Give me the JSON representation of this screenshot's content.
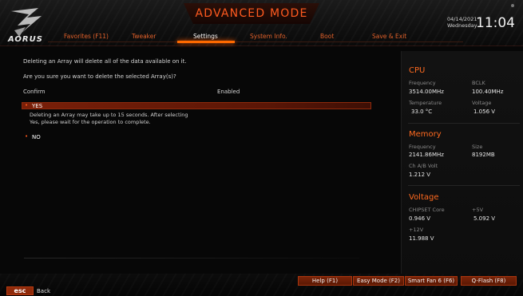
{
  "header": {
    "logo_text": "AORUS",
    "title": "ADVANCED MODE",
    "tabs": [
      {
        "label": "Favorites (F11)"
      },
      {
        "label": "Tweaker"
      },
      {
        "label": "Settings"
      },
      {
        "label": "System Info."
      },
      {
        "label": "Boot"
      },
      {
        "label": "Save & Exit"
      }
    ],
    "active_tab": "Settings",
    "date": "04/14/2021",
    "weekday": "Wednesday",
    "time": "11:04"
  },
  "main": {
    "warning": "Deleting an Array will delete all of the data available on it.",
    "question": "Are you sure you want to delete the selected Array(s)?",
    "confirm_label": "Confirm",
    "confirm_value": "Enabled",
    "options": [
      {
        "label": "YES",
        "selected": true
      },
      {
        "label": "NO",
        "selected": false
      }
    ],
    "yes_description_line1": "Deleting an Array may take up to 15 seconds. After selecting",
    "yes_description_line2": "Yes, please wait for the operation to complete."
  },
  "panel": {
    "cpu": {
      "title": "CPU",
      "frequency_label": "Frequency",
      "frequency_value": "3514.00MHz",
      "bclk_label": "BCLK",
      "bclk_value": "100.40MHz",
      "temperature_label": "Temperature",
      "temperature_value": "33.0 °C",
      "voltage_label": "Voltage",
      "voltage_value": "1.056 V"
    },
    "memory": {
      "title": "Memory",
      "frequency_label": "Frequency",
      "frequency_value": "2141.86MHz",
      "size_label": "Size",
      "size_value": "8192MB",
      "chab_label": "Ch A/B Volt",
      "chab_value": "1.212 V"
    },
    "voltage": {
      "title": "Voltage",
      "chipset_label": "CHIPSET Core",
      "chipset_value": "0.946 V",
      "p5v_label": "+5V",
      "p5v_value": "5.092 V",
      "p12v_label": "+12V",
      "p12v_value": "11.988 V"
    }
  },
  "footer": {
    "buttons": [
      {
        "label": "Help (F1)"
      },
      {
        "label": "Easy Mode (F2)"
      },
      {
        "label": "Smart Fan 6 (F6)"
      },
      {
        "label": "Q-Flash (F8)"
      }
    ],
    "esc_key": "esc",
    "esc_label": "Back"
  },
  "colors": {
    "accent": "#ff5a1f",
    "highlight_row": "#7a1f08",
    "background": "#070707"
  },
  "icons": {
    "logo": "aorus-eagle-logo",
    "bullet": "orange-dot-bullet"
  }
}
